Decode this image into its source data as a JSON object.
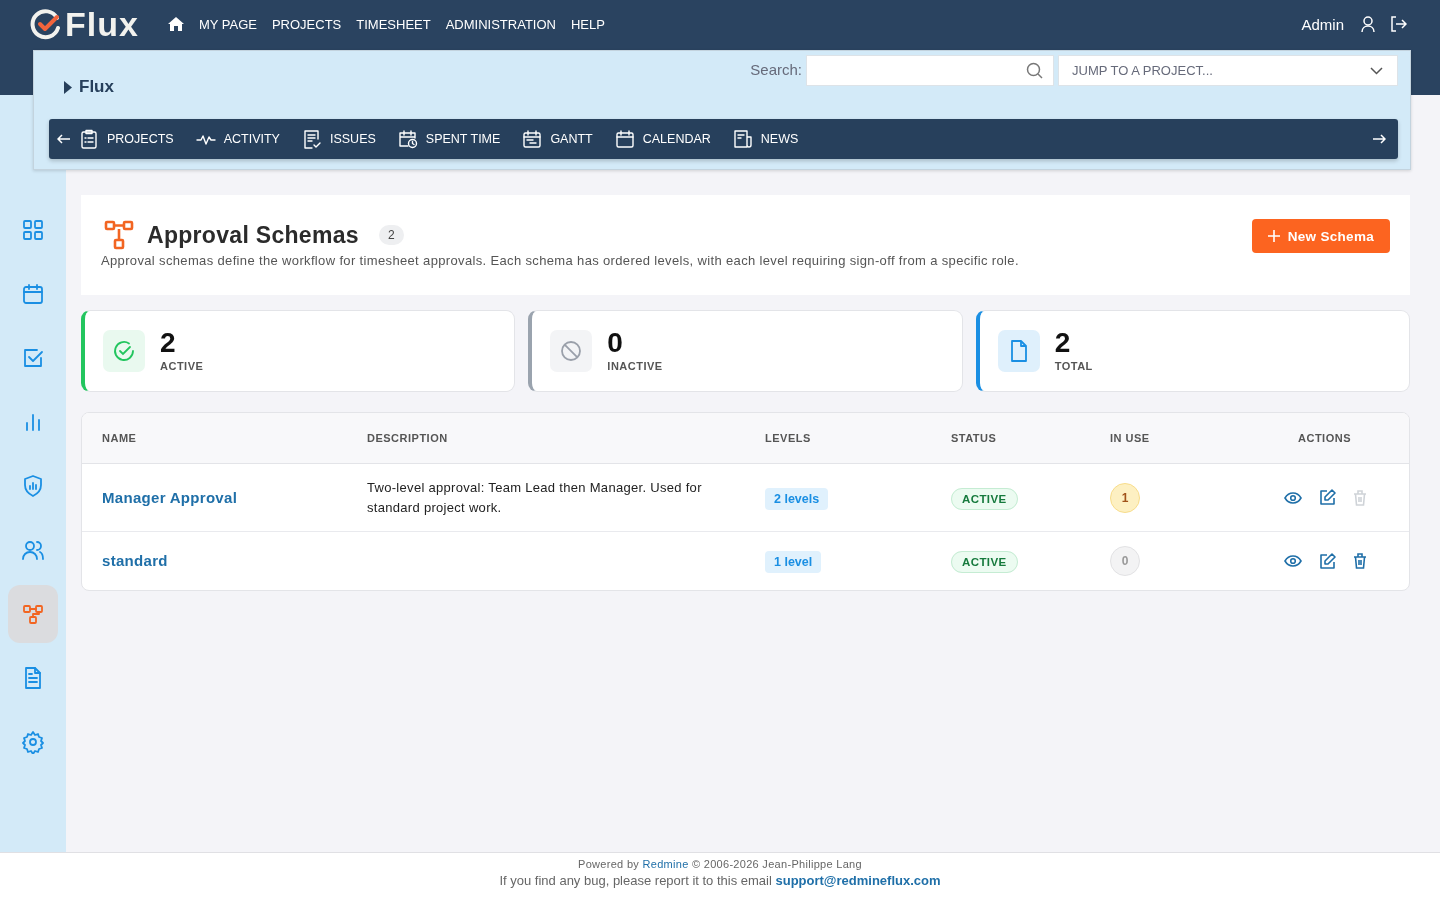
{
  "header": {
    "logo": "Flux",
    "nav": [
      "MY PAGE",
      "PROJECTS",
      "TIMESHEET",
      "ADMINISTRATION",
      "HELP"
    ],
    "user": "Admin"
  },
  "project_bar": {
    "title": "Flux",
    "search_label": "Search:",
    "jump_placeholder": "JUMP TO A PROJECT...",
    "menu": [
      {
        "label": "PROJECTS",
        "selected": false
      },
      {
        "label": "ACTIVITY",
        "selected": false
      },
      {
        "label": "ISSUES",
        "selected": false
      },
      {
        "label": "SPENT TIME",
        "selected": false
      },
      {
        "label": "GANTT",
        "selected": false
      },
      {
        "label": "CALENDAR",
        "selected": false
      },
      {
        "label": "NEWS",
        "selected": false
      }
    ]
  },
  "sidebar": {
    "items": [
      {
        "selected": false
      },
      {
        "selected": false
      },
      {
        "selected": false
      },
      {
        "selected": false
      },
      {
        "selected": false
      },
      {
        "selected": false
      },
      {
        "selected": true
      },
      {
        "selected": false
      },
      {
        "selected": false
      }
    ]
  },
  "page": {
    "title": "Approval Schemas",
    "count": "2",
    "description": "Approval schemas define the workflow for timesheet approvals. Each schema has ordered levels, with each level requiring sign-off from a specific role.",
    "new_button": "New Schema"
  },
  "stats": [
    {
      "kind": "active",
      "value": "2",
      "label": "ACTIVE"
    },
    {
      "kind": "inactive",
      "value": "0",
      "label": "INACTIVE"
    },
    {
      "kind": "total",
      "value": "2",
      "label": "TOTAL"
    }
  ],
  "table": {
    "columns": [
      "NAME",
      "DESCRIPTION",
      "LEVELS",
      "STATUS",
      "IN USE",
      "ACTIONS"
    ],
    "rows": [
      {
        "name": "Manager Approval",
        "description": "Two-level approval: Team Lead then Manager. Used for standard project work.",
        "levels": "2 levels",
        "status": "ACTIVE",
        "in_use": "1",
        "used": true,
        "delete_disabled": true
      },
      {
        "name": "standard",
        "levels": "1 level",
        "status": "ACTIVE",
        "in_use": "0",
        "used": false,
        "delete_disabled": false
      }
    ]
  },
  "footer": {
    "powered_prefix": "Powered by",
    "powered_link": "Redmine",
    "powered_suffix": "© 2006-2026 Jean-Philippe Lang",
    "bug_text": "If you find any bug, please report it to this email",
    "email": "support@redmineflux.com"
  }
}
